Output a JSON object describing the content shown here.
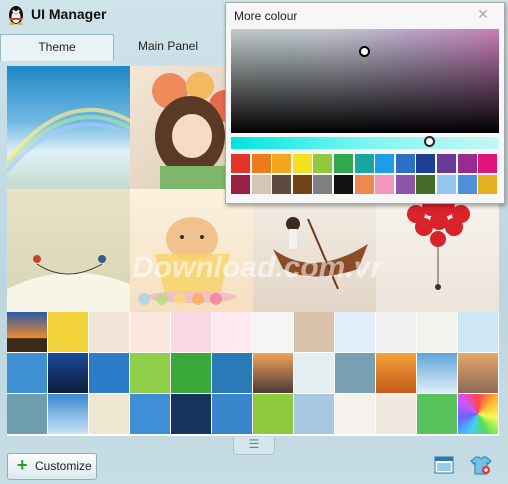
{
  "app": {
    "title": "UI Manager"
  },
  "tabs": [
    {
      "label": "Theme",
      "active": true
    },
    {
      "label": "Main Panel",
      "active": false
    }
  ],
  "gallery": {
    "watermark": "Download.com.vn"
  },
  "popup": {
    "title": "More colour",
    "swatches_row1": [
      "#e3342a",
      "#ef7a1a",
      "#f4a71d",
      "#f5e11f",
      "#92c83e",
      "#2fa84f",
      "#19a6a0",
      "#1d9ce8",
      "#2b6fc6",
      "#1b3f91",
      "#6a3a9b",
      "#962c8e",
      "#e0147b"
    ],
    "swatches_row2": [
      "#9a1f45",
      "#d5c6b4",
      "#5c4a3e",
      "#714317",
      "#7f7f7f",
      "#111111",
      "#f1864e",
      "#f497b9",
      "#8f54a8",
      "#436c28",
      "#93c6ee",
      "#4f8edb",
      "#e4b021"
    ]
  },
  "footer": {
    "customize_label": "Customize",
    "grip_glyph": "☰"
  },
  "icons": {
    "app": "qq-penguin-icon",
    "close": "close-icon",
    "add": "plus-icon",
    "background": "background-window-icon",
    "skin": "shirt-skin-icon",
    "grip": "menu-grip-icon"
  }
}
